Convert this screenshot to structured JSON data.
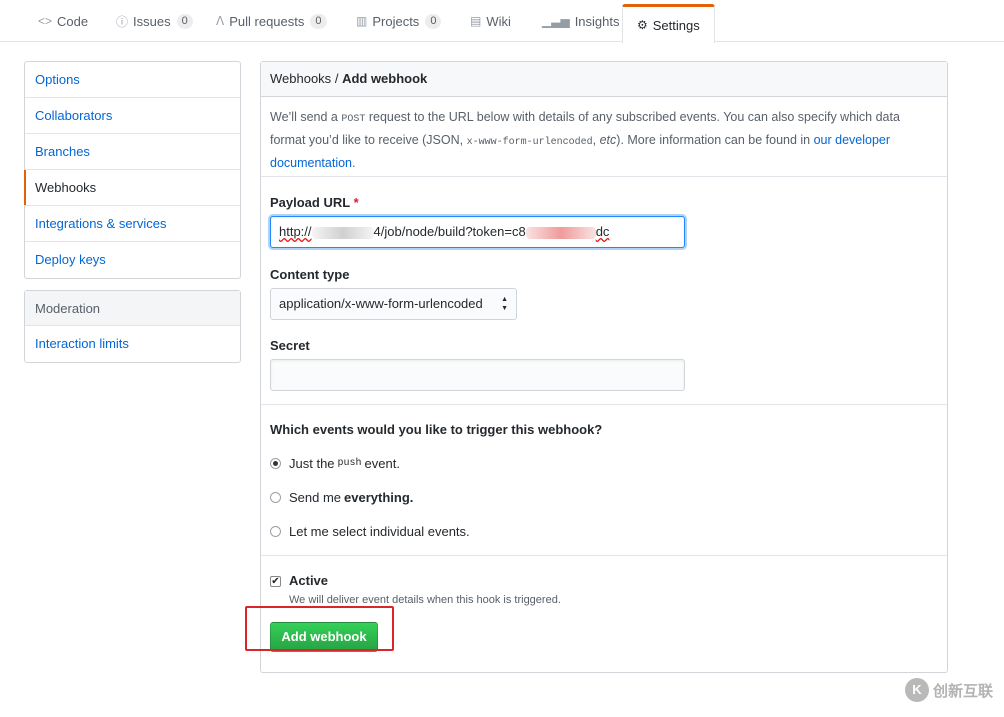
{
  "tabs": [
    {
      "label": "Code",
      "icon": "code-icon"
    },
    {
      "label": "Issues",
      "icon": "issue-icon",
      "count": "0"
    },
    {
      "label": "Pull requests",
      "icon": "git-pull-request-icon",
      "count": "0"
    },
    {
      "label": "Projects",
      "icon": "project-icon",
      "count": "0"
    },
    {
      "label": "Wiki",
      "icon": "book-icon"
    },
    {
      "label": "Insights",
      "icon": "graph-icon"
    },
    {
      "label": "Settings",
      "icon": "gear-icon",
      "selected": true
    }
  ],
  "sidebar": {
    "items": [
      "Options",
      "Collaborators",
      "Branches",
      "Webhooks",
      "Integrations & services",
      "Deploy keys"
    ],
    "selected": "Webhooks",
    "moderation": {
      "heading": "Moderation",
      "items": [
        "Interaction limits"
      ]
    }
  },
  "breadcrumb": {
    "parent": "Webhooks",
    "separator": "/",
    "current": "Add webhook"
  },
  "intro": {
    "part1": "We’ll send a ",
    "code1": "POST",
    "part2": " request to the URL below with details of any subscribed events. You can also specify which data format you’d like to receive (JSON, ",
    "code2": "x-www-form-urlencoded",
    "part3": ", ",
    "em": "etc",
    "part4": "). More information can be found in ",
    "link": "our developer documentation",
    "part5": "."
  },
  "form": {
    "payload_label": "Payload URL",
    "required_mark": "*",
    "payload_prefix": "http://",
    "payload_middle": "4/job/node/build?token=c8",
    "payload_suffix": "dc",
    "content_type_label": "Content type",
    "content_type_value": "application/x-www-form-urlencoded",
    "secret_label": "Secret",
    "secret_value": ""
  },
  "events": {
    "question": "Which events would you like to trigger this webhook?",
    "options": [
      {
        "pre": "Just the",
        "code": "push",
        "post": "event.",
        "checked": true
      },
      {
        "pre": "Send me",
        "strong": "everything.",
        "checked": false
      },
      {
        "pre": "Let me select individual events.",
        "checked": false
      }
    ]
  },
  "active": {
    "label": "Active",
    "checked": true,
    "note": "We will deliver event details when this hook is triggered."
  },
  "submit_label": "Add webhook",
  "colors": {
    "accent": "#e36209",
    "link": "#0366d6",
    "button": "#28a745",
    "highlight": "#d9262b"
  },
  "watermark": {
    "logo": "K",
    "text": "创新互联"
  }
}
